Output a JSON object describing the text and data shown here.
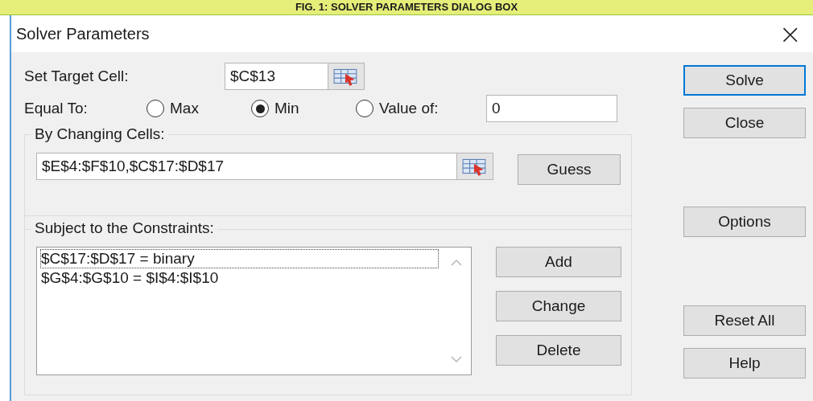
{
  "caption": "FIG. 1: SOLVER PARAMETERS DIALOG BOX",
  "window": {
    "title": "Solver Parameters",
    "close": "×"
  },
  "target": {
    "label": "Set Target Cell:",
    "value": "$C$13"
  },
  "equal_to": {
    "label": "Equal To:",
    "options": [
      {
        "label": "Max",
        "selected": false
      },
      {
        "label": "Min",
        "selected": true
      },
      {
        "label": "Value of:",
        "selected": false
      }
    ],
    "value": "0"
  },
  "changing": {
    "label": "By Changing Cells:",
    "value": "$E$4:$F$10,$C$17:$D$17",
    "button": {
      "label": "Guess"
    }
  },
  "constraints": {
    "label": "Subject to the Constraints:",
    "items": [
      {
        "text": "$C$17:$D$17 = binary",
        "selected": true
      },
      {
        "text": "$G$4:$G$10 = $I$4:$I$10",
        "selected": false
      }
    ],
    "buttons": [
      {
        "label": "Add"
      },
      {
        "label": "Change"
      },
      {
        "label": "Delete"
      }
    ]
  },
  "side_buttons": [
    {
      "label": "Solve",
      "default": true
    },
    {
      "label": "Close",
      "default": false
    },
    {
      "label": "Options",
      "default": false
    },
    {
      "label": "Reset All",
      "default": false
    },
    {
      "label": "Help",
      "default": false
    }
  ]
}
